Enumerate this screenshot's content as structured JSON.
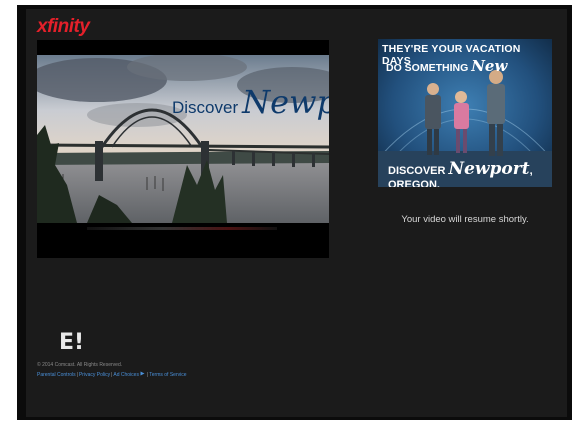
{
  "brand": {
    "logo_text": "xfinity"
  },
  "player": {
    "headline_word1": "Discover",
    "headline_word2": "Newport"
  },
  "ad": {
    "line1": "THEY'RE YOUR VACATION DAYS",
    "line2_prefix": "DO SOMETHING",
    "line2_script": "New",
    "bottom_prefix": "DISCOVER",
    "bottom_script": "Newport",
    "bottom_suffix": ", OREGON."
  },
  "status": {
    "resume_text": "Your video will resume shortly."
  },
  "footer": {
    "network_logo": "E!",
    "copyright": "© 2014 Comcast. All Rights Reserved.",
    "links": [
      "Parental Controls",
      "Privacy Policy",
      "Ad Choices",
      "Terms of Service"
    ]
  },
  "colors": {
    "brand_red": "#e4202a",
    "link_blue": "#4a90d9",
    "page_bg": "#1b1b1b"
  }
}
